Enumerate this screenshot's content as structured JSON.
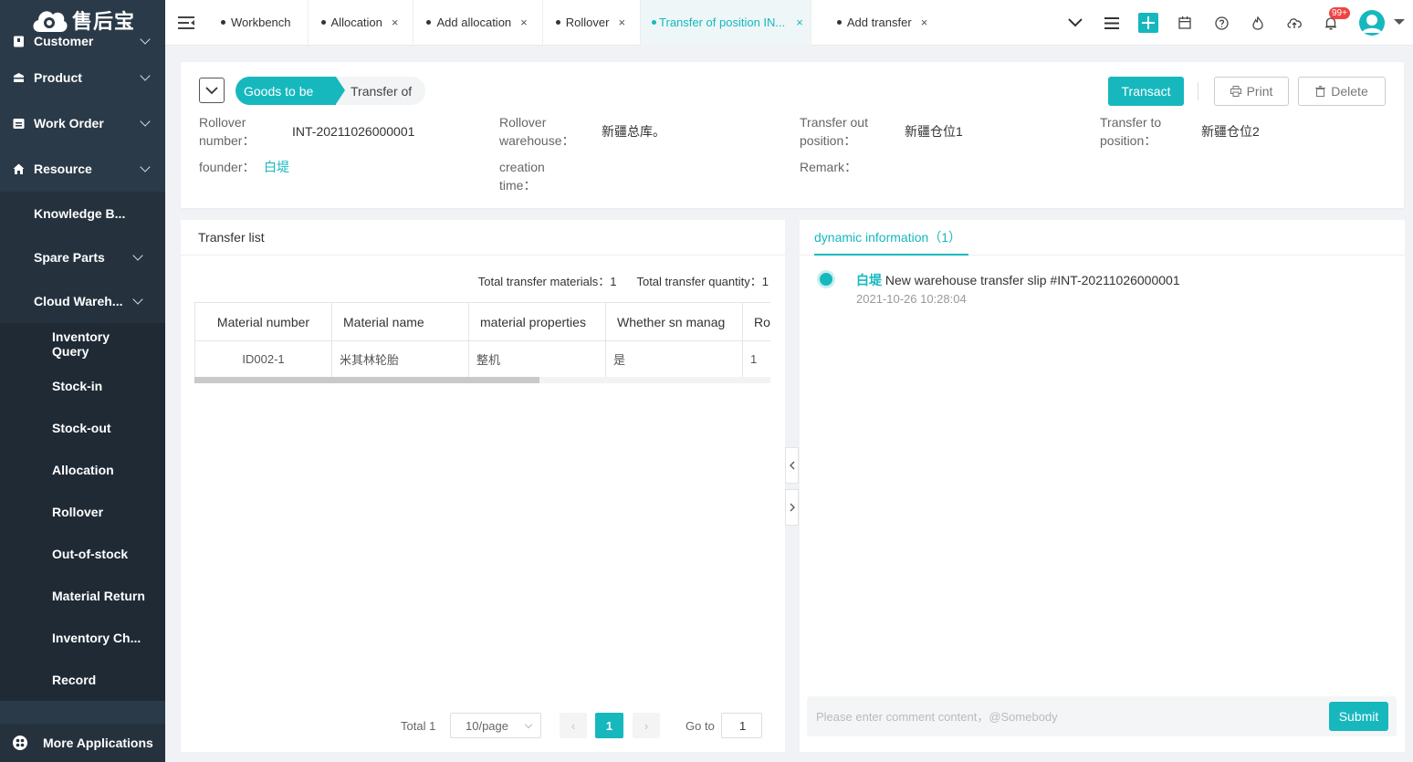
{
  "app": {
    "logo_text": "售后宝"
  },
  "sidebar": {
    "groups": [
      {
        "label": "Customer",
        "icon": "customer-icon"
      },
      {
        "label": "Product",
        "icon": "product-icon"
      },
      {
        "label": "Work Order",
        "icon": "work-order-icon"
      },
      {
        "label": "Resource",
        "icon": "resource-icon"
      }
    ],
    "resource_items": [
      {
        "label": "Knowledge B..."
      },
      {
        "label": "Spare Parts"
      },
      {
        "label": "Cloud Wareh..."
      }
    ],
    "warehouse_items": [
      {
        "label": "Inventory Query"
      },
      {
        "label": "Stock-in"
      },
      {
        "label": "Stock-out"
      },
      {
        "label": "Allocation"
      },
      {
        "label": "Rollover"
      },
      {
        "label": "Out-of-stock"
      },
      {
        "label": "Material Return"
      },
      {
        "label": "Inventory Ch..."
      },
      {
        "label": "Record"
      }
    ],
    "more_apps": "More Applications"
  },
  "tabs": [
    {
      "label": "Workbench",
      "closable": false,
      "active": false
    },
    {
      "label": "Allocation",
      "closable": true,
      "active": false
    },
    {
      "label": "Add allocation",
      "closable": true,
      "active": false
    },
    {
      "label": "Rollover",
      "closable": true,
      "active": false
    },
    {
      "label": "Transfer of position IN...",
      "closable": true,
      "active": true
    },
    {
      "label": "Add transfer",
      "closable": true,
      "active": false
    }
  ],
  "topbar": {
    "notification_badge": "99+"
  },
  "header": {
    "steps": [
      "Goods to be",
      "Transfer of"
    ],
    "buttons": {
      "transact": "Transact",
      "print": "Print",
      "delete": "Delete"
    },
    "fields": {
      "rollover_number_label": "Rollover number：",
      "rollover_number": "INT-20211026000001",
      "rollover_warehouse_label": "Rollover warehouse：",
      "rollover_warehouse": "新疆总库。",
      "transfer_out_label": "Transfer out position：",
      "transfer_out": "新疆仓位1",
      "transfer_to_label": "Transfer to position：",
      "transfer_to": "新疆仓位2",
      "founder_label": "founder：",
      "founder": "白堤",
      "creation_time_label": "creation time：",
      "creation_time": "",
      "remark_label": "Remark：",
      "remark": ""
    }
  },
  "transfer_list": {
    "title": "Transfer list",
    "total_materials_label": "Total transfer materials：",
    "total_materials": "1",
    "total_quantity_label": "Total transfer quantity：",
    "total_quantity": "1",
    "columns": [
      "Material number",
      "Material name",
      "material properties",
      "Whether sn manag",
      "Ro"
    ],
    "rows": [
      [
        "ID002-1",
        "米其林轮胎",
        "整机",
        "是",
        "1"
      ]
    ],
    "pagination": {
      "total": "Total 1",
      "page_size": "10/page",
      "current_page": "1",
      "goto_label": "Go to",
      "goto_value": "1"
    }
  },
  "dynamic": {
    "tab_label": "dynamic information（1）",
    "entries": [
      {
        "user": "白堤",
        "text": "New warehouse transfer slip #INT-20211026000001",
        "time": "2021-10-26 10:28:04"
      }
    ],
    "comment_placeholder": "Please enter comment content，@Somebody",
    "submit": "Submit"
  },
  "colors": {
    "accent": "#16b8be",
    "sidebar": "#2b3a48",
    "badge": "#f04444"
  }
}
